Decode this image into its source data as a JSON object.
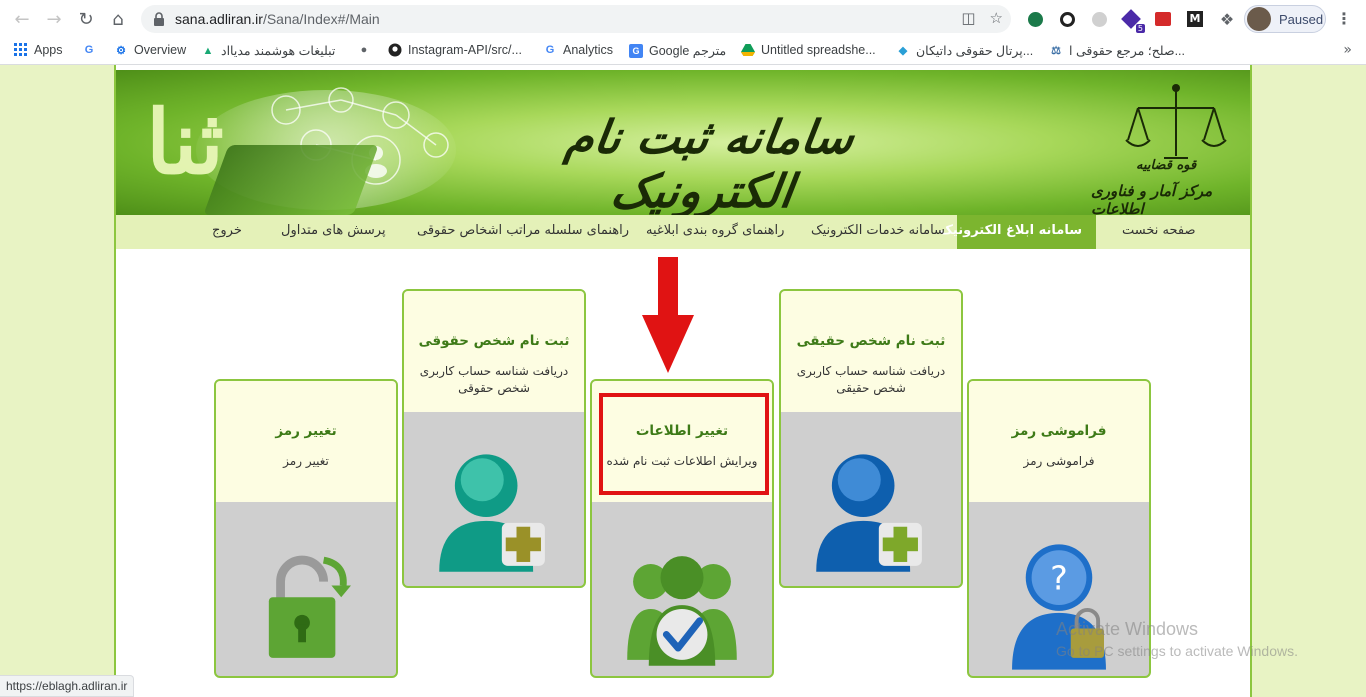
{
  "browser": {
    "url_host": "sana.adliran.ir",
    "url_path": "/Sana/Index#/Main",
    "profile_status": "Paused",
    "extension_badge": "5",
    "status_url": "https://eblagh.adliran.ir"
  },
  "bookmarks": [
    {
      "label": "Apps",
      "icon": "apps-grid-icon"
    },
    {
      "label": "",
      "icon": "google-icon"
    },
    {
      "label": "Overview",
      "icon": "overview-icon"
    },
    {
      "label": "تبلیغات هوشمند مدیااد",
      "icon": "mediaad-icon"
    },
    {
      "label": "",
      "icon": "globe-icon"
    },
    {
      "label": "Instagram-API/src/...",
      "icon": "github-icon"
    },
    {
      "label": "Analytics",
      "icon": "google-icon"
    },
    {
      "label": "Google مترجم",
      "icon": "translate-icon"
    },
    {
      "label": "Untitled spreadshe...",
      "icon": "drive-icon"
    },
    {
      "label": "پرتال حقوقی داتیکان...",
      "icon": "diamond-icon"
    },
    {
      "label": "صلح؛ مرجع حقوقی ا...",
      "icon": "scales-icon"
    }
  ],
  "banner": {
    "title": "سامانه ثبت نام الکترونیک",
    "side_letters": "ثنا",
    "emblem_line1": "قوه قضاییه",
    "emblem_line2": "مرکز آمار و فناوری اطلاعات"
  },
  "menu": [
    {
      "label": "صفحه نخست",
      "active": false
    },
    {
      "label": "سامانه ابلاغ الکترونیک",
      "active": true
    },
    {
      "label": "سامانه خدمات الکترونیک",
      "active": false
    },
    {
      "label": "راهنمای گروه بندی ابلاغیه",
      "active": false
    },
    {
      "label": "راهنمای سلسله مراتب اشخاص حقوقی",
      "active": false
    },
    {
      "label": "پرسش های متداول",
      "active": false
    },
    {
      "label": "خروج",
      "active": false
    }
  ],
  "cards": [
    {
      "id": "forgot",
      "title": "فراموشی رمز",
      "sub": "فراموشی رمز",
      "icon": "forgot-password-icon"
    },
    {
      "id": "natural",
      "title": "ثبت نام شخص حقیقی",
      "sub": "دریافت شناسه حساب کاربری شخص حقیقی",
      "icon": "add-natural-person-icon"
    },
    {
      "id": "edit",
      "title": "تغییر اطلاعات",
      "sub": "ویرایش اطلاعات ثبت نام شده",
      "icon": "edit-info-icon"
    },
    {
      "id": "legal",
      "title": "ثبت نام شخص حقوقی",
      "sub": "دریافت شناسه حساب کاربری شخص حقوقی",
      "icon": "add-legal-person-icon"
    },
    {
      "id": "password",
      "title": "تغییر رمز",
      "sub": "تغییر رمز",
      "icon": "change-password-icon"
    }
  ],
  "watermark": {
    "line1": "Activate Windows",
    "line2": "Go to PC settings to activate Windows."
  },
  "colors": {
    "accent": "#7cb52f",
    "card_border": "#8cc63f",
    "card_title": "#3d7a17",
    "highlight": "#e01313"
  }
}
